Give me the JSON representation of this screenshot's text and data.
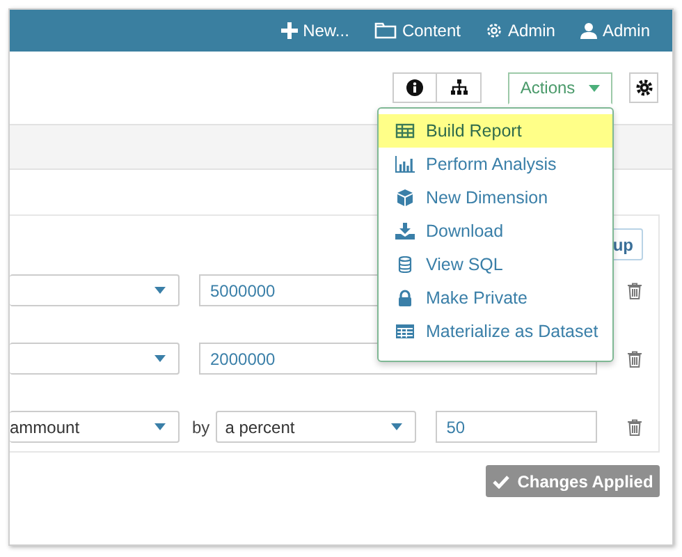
{
  "top_bar": {
    "items": [
      {
        "kind": "plus",
        "label": "New..."
      },
      {
        "kind": "folder",
        "label": "Content"
      },
      {
        "kind": "gear",
        "label": "Admin"
      },
      {
        "kind": "user",
        "label": "Admin"
      }
    ]
  },
  "toolbar": {
    "actions": {
      "label": "Actions",
      "expanded": true
    }
  },
  "actions_menu": [
    {
      "kind": "report",
      "label": "Build Report",
      "selected": true
    },
    {
      "kind": "chart",
      "label": "Perform Analysis",
      "selected": false
    },
    {
      "kind": "cube",
      "label": "New Dimension",
      "selected": false
    },
    {
      "kind": "download",
      "label": "Download",
      "selected": false
    },
    {
      "kind": "database",
      "label": "View SQL",
      "selected": false
    },
    {
      "kind": "lock",
      "label": "Make Private",
      "selected": false
    },
    {
      "kind": "table",
      "label": "Materialize as Dataset",
      "selected": false
    }
  ],
  "card": {
    "group_button": "up",
    "rows": [
      {
        "fields": [
          {
            "kind": "select"
          },
          {
            "kind": "input",
            "value": "5000000"
          }
        ]
      },
      {
        "fields": [
          {
            "kind": "select"
          },
          {
            "kind": "input",
            "value": "2000000"
          }
        ]
      },
      {
        "fields": [
          {
            "kind": "select",
            "value": "ammount"
          },
          {
            "kind": "label",
            "value": "by"
          },
          {
            "kind": "select",
            "value": "a percent"
          },
          {
            "kind": "input",
            "value": "50"
          }
        ]
      }
    ]
  },
  "apply_button": {
    "label": "Changes Applied",
    "disabled": true
  }
}
